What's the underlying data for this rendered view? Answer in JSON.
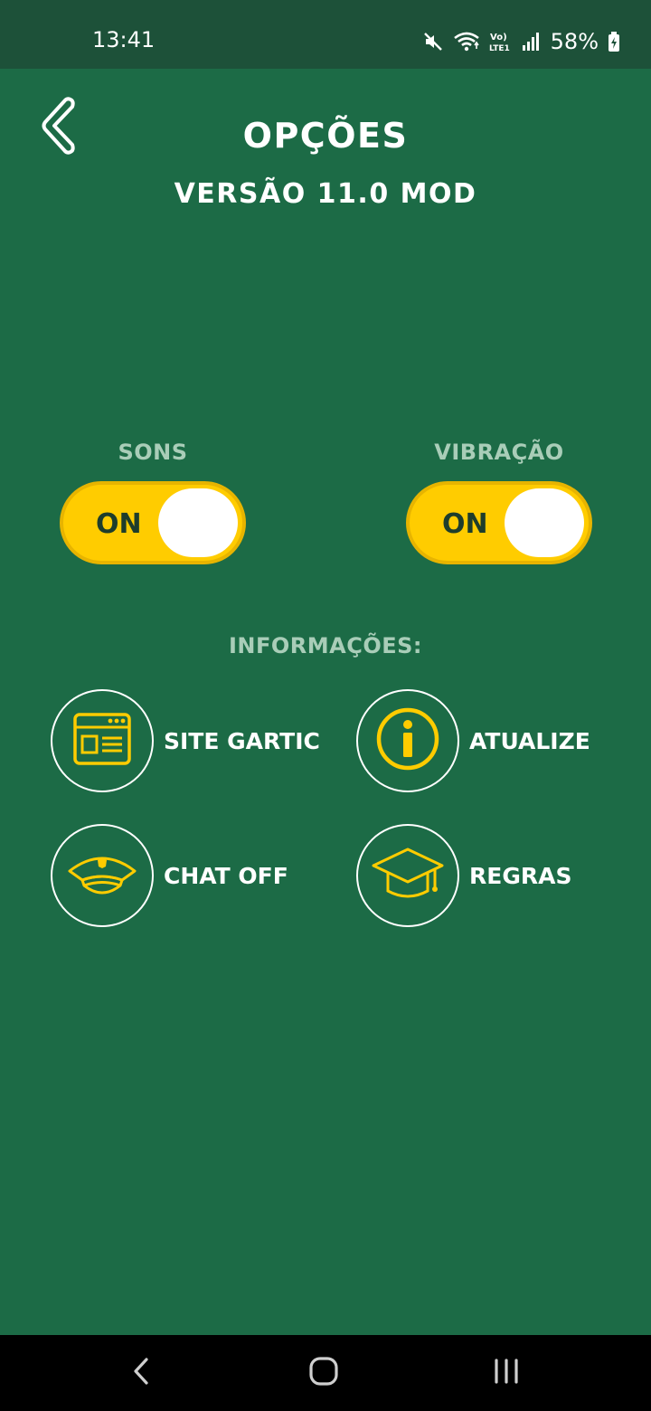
{
  "status_bar": {
    "time": "13:41",
    "battery": "58%",
    "icons": [
      "mute-icon",
      "wifi-icon",
      "volte-icon",
      "signal-icon",
      "battery-icon"
    ]
  },
  "header": {
    "title": "OPÇÕES",
    "version": "VERSÃO 11.0 MOD"
  },
  "toggles": {
    "sons": {
      "label": "SONS",
      "state": "ON"
    },
    "vibracao": {
      "label": "VIBRAÇÃO",
      "state": "ON"
    }
  },
  "info": {
    "title": "INFORMAÇÕES:",
    "items": [
      {
        "label": "SITE GARTIC",
        "icon": "website-icon"
      },
      {
        "label": "ATUALIZE",
        "icon": "info-icon"
      },
      {
        "label": "CHAT OFF",
        "icon": "police-cap-icon"
      },
      {
        "label": "REGRAS",
        "icon": "graduation-cap-icon"
      }
    ]
  },
  "colors": {
    "background": "#1c6b46",
    "status_bar": "#1d5139",
    "accent": "#ffcc00",
    "muted_label": "#a9cdb8",
    "toggle_text": "#1e3d2c"
  }
}
